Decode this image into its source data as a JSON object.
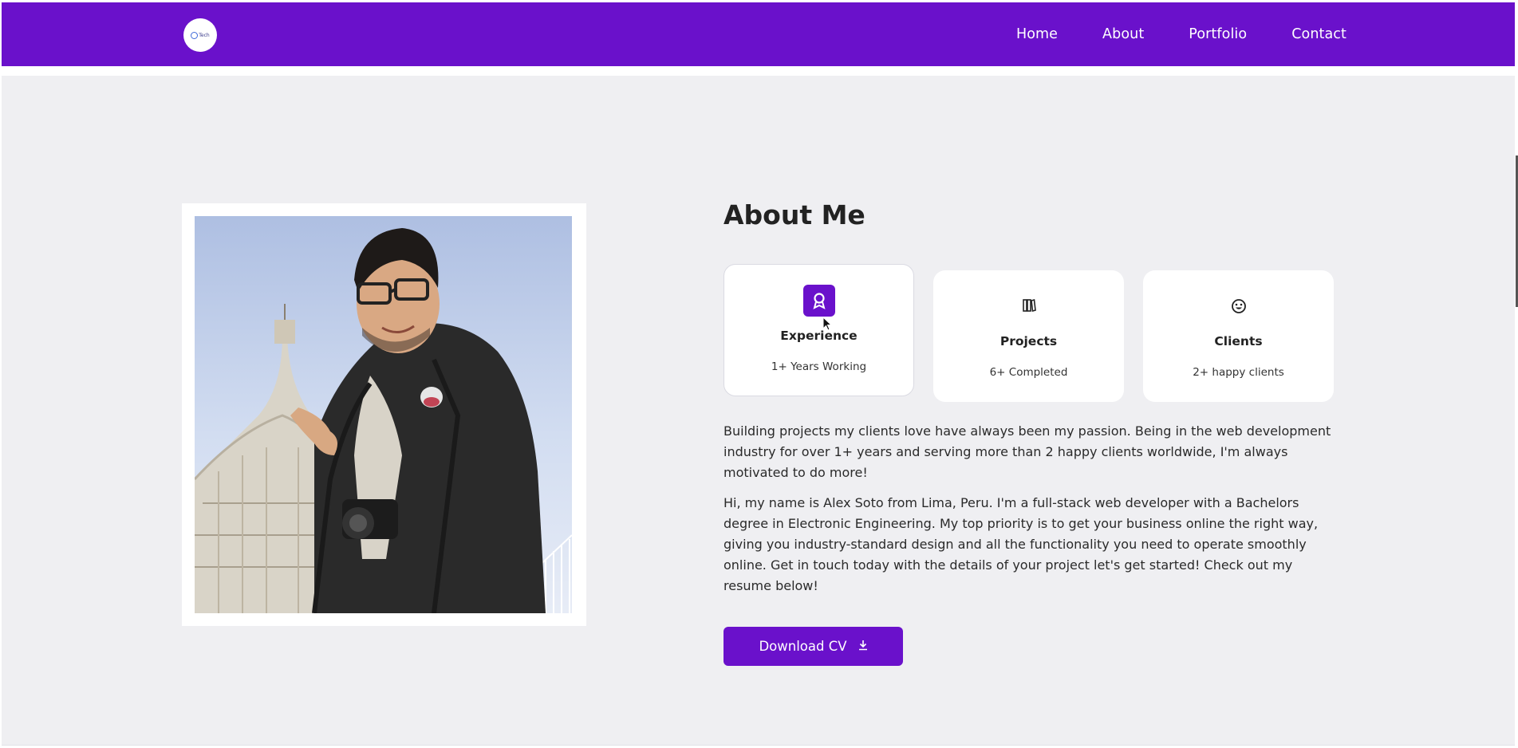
{
  "nav": {
    "logo_text": "Tech",
    "links": [
      "Home",
      "About",
      "Portfolio",
      "Contact"
    ]
  },
  "about": {
    "title": "About Me",
    "photo_alt": "Man taking a selfie in front of a cathedral dome",
    "cards": [
      {
        "icon": "award-icon",
        "title": "Experience",
        "subtitle": "1+ Years Working"
      },
      {
        "icon": "books-icon",
        "title": "Projects",
        "subtitle": "6+ Completed"
      },
      {
        "icon": "smile-icon",
        "title": "Clients",
        "subtitle": "2+ happy clients"
      }
    ],
    "paragraph1": "Building projects my clients love have always been my passion. Being in the web development industry for over 1+ years and serving more than 2 happy clients worldwide, I'm always motivated to do more!",
    "paragraph2": "Hi, my name is Alex Soto from Lima, Peru. I'm a full-stack web developer with a Bachelors degree in Electronic Engineering. My top priority is to get your business online the right way, giving you industry-standard design and all the functionality you need to operate smoothly online. Get in touch today with the details of your project let's get started! Check out my resume below!",
    "cv_button": "Download CV"
  },
  "colors": {
    "brand": "#6a11cb",
    "section_bg": "#efeff2"
  }
}
